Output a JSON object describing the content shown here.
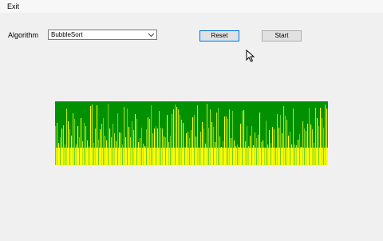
{
  "menu": {
    "exit_label": "Exit"
  },
  "algorithm": {
    "label": "Algorithm",
    "selected": "BubbleSort"
  },
  "buttons": {
    "reset_label": "Reset",
    "start_label": "Start"
  },
  "visualizer": {
    "background_color": "#009000",
    "bar_colors": [
      "#ffff00",
      "#b6e61a",
      "#6fd02b"
    ],
    "bar_count": 171,
    "state": "unsorted (random bar heights)"
  }
}
